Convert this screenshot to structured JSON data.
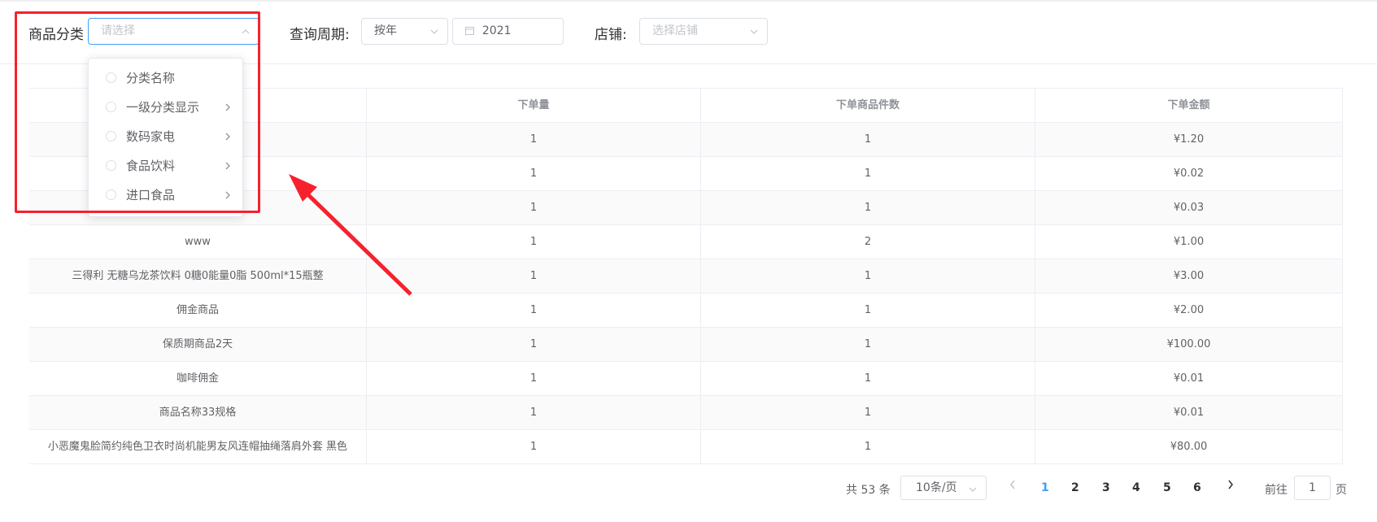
{
  "filters": {
    "category_label": "商品分类",
    "category_placeholder": "请选择",
    "period_label": "查询周期:",
    "period_value": "按年",
    "year_value": "2021",
    "store_label": "店铺:",
    "store_placeholder": "选择店铺"
  },
  "dropdown": {
    "items": [
      {
        "label": "分类名称",
        "has_children": false
      },
      {
        "label": "一级分类显示",
        "has_children": true
      },
      {
        "label": "数码家电",
        "has_children": true
      },
      {
        "label": "食品饮料",
        "has_children": true
      },
      {
        "label": "进口食品",
        "has_children": true
      }
    ]
  },
  "table": {
    "headers": [
      "",
      "下单量",
      "下单商品件数",
      "下单金额"
    ],
    "rows": [
      {
        "name": "",
        "orders": "1",
        "items": "1",
        "amount": "¥1.20"
      },
      {
        "name": "",
        "orders": "1",
        "items": "1",
        "amount": "¥0.02"
      },
      {
        "name": "",
        "orders": "1",
        "items": "1",
        "amount": "¥0.03"
      },
      {
        "name": "www",
        "orders": "1",
        "items": "2",
        "amount": "¥1.00"
      },
      {
        "name": "三得利 无糖乌龙茶饮料 0糖0能量0脂 500ml*15瓶整",
        "orders": "1",
        "items": "1",
        "amount": "¥3.00"
      },
      {
        "name": "佣金商品",
        "orders": "1",
        "items": "1",
        "amount": "¥2.00"
      },
      {
        "name": "保质期商品2天",
        "orders": "1",
        "items": "1",
        "amount": "¥100.00"
      },
      {
        "name": "咖啡佣金",
        "orders": "1",
        "items": "1",
        "amount": "¥0.01"
      },
      {
        "name": "商品名称33规格",
        "orders": "1",
        "items": "1",
        "amount": "¥0.01"
      },
      {
        "name": "小恶魔鬼脸简约纯色卫衣时尚机能男友风连帽抽绳落肩外套 黑色",
        "orders": "1",
        "items": "1",
        "amount": "¥80.00"
      }
    ]
  },
  "pagination": {
    "total": "共 53 条",
    "page_size": "10条/页",
    "pages": [
      "1",
      "2",
      "3",
      "4",
      "5",
      "6"
    ],
    "current_page": "1",
    "goto_label": "前往",
    "goto_value": "1",
    "page_suffix": "页"
  },
  "colors": {
    "accent": "#409eff",
    "highlight": "#f5222d"
  }
}
